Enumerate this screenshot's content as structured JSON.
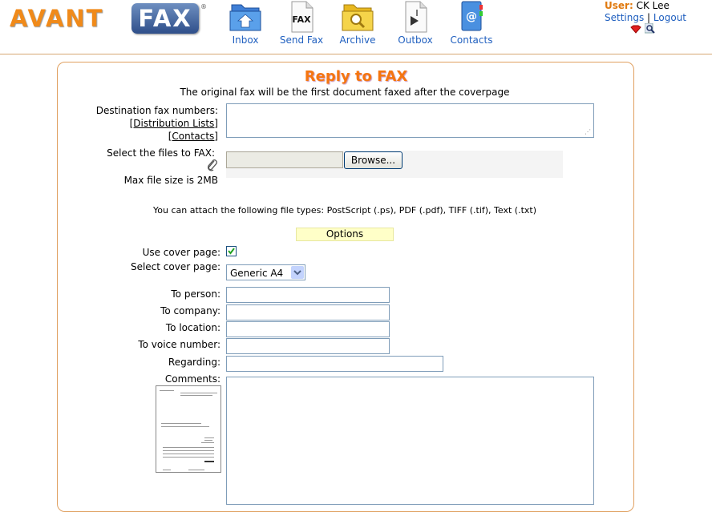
{
  "app": {
    "logo_left": "AVANT",
    "logo_right": "FAX",
    "logo_reg": "®"
  },
  "nav": [
    {
      "label": "Inbox",
      "icon": "inbox-folder-icon"
    },
    {
      "label": "Send Fax",
      "icon": "send-fax-icon"
    },
    {
      "label": "Archive",
      "icon": "archive-folder-icon"
    },
    {
      "label": "Outbox",
      "icon": "outbox-icon"
    },
    {
      "label": "Contacts",
      "icon": "contacts-book-icon"
    }
  ],
  "user": {
    "label": "User:",
    "name": "CK Lee",
    "settings": "Settings",
    "separator": "|",
    "logout": "Logout"
  },
  "page": {
    "title": "Reply to FAX",
    "subtitle": "The original fax will be the first document faxed after the coverpage"
  },
  "form": {
    "destination_label": "Destination fax numbers:",
    "distribution_lists": "[Distribution Lists]",
    "contacts_link": "[Contacts]",
    "select_files_label": "Select the files to FAX:",
    "browse_label": "Browse...",
    "max_file_size": "Max file size is 2MB",
    "file_types": "You can attach the following file types: PostScript (.ps), PDF (.pdf), TIFF (.tif), Text (.txt)",
    "options_label": "Options",
    "use_cover_label": "Use cover page:",
    "use_cover_checked": true,
    "select_cover_label": "Select cover page:",
    "cover_selected": "Generic A4",
    "to_person_label": "To person:",
    "to_company_label": "To company:",
    "to_location_label": "To location:",
    "to_voice_label": "To voice number:",
    "regarding_label": "Regarding:",
    "comments_label": "Comments:"
  },
  "colors": {
    "accent_orange": "#f5760f",
    "link_blue": "#1f5fbf",
    "panel_border": "#e0a060",
    "options_bg": "#ffffc8"
  }
}
